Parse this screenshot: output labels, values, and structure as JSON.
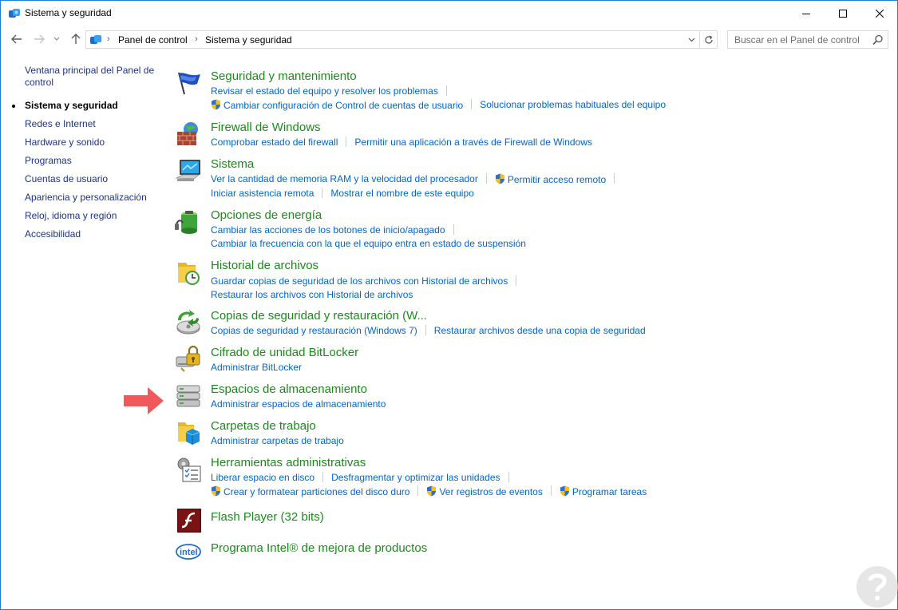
{
  "window": {
    "title": "Sistema y seguridad"
  },
  "address": {
    "breadcrumb": [
      "Panel de control",
      "Sistema y seguridad"
    ]
  },
  "search": {
    "placeholder": "Buscar en el Panel de control"
  },
  "sidebar": {
    "items": [
      {
        "label": "Ventana principal del Panel de control"
      },
      {
        "label": "Sistema y seguridad"
      },
      {
        "label": "Redes e Internet"
      },
      {
        "label": "Hardware y sonido"
      },
      {
        "label": "Programas"
      },
      {
        "label": "Cuentas de usuario"
      },
      {
        "label": "Apariencia y personalización"
      },
      {
        "label": "Reloj, idioma y región"
      },
      {
        "label": "Accesibilidad"
      }
    ]
  },
  "categories": [
    {
      "title": "Seguridad y mantenimiento",
      "icon": "flag-icon",
      "links": [
        "Revisar el estado del equipo y resolver los problemas",
        "Cambiar configuración de Control de cuentas de usuario",
        "Solucionar problemas habituales del equipo"
      ]
    },
    {
      "title": "Firewall de Windows",
      "icon": "firewall-icon",
      "links": [
        "Comprobar estado del firewall",
        "Permitir una aplicación a través de Firewall de Windows"
      ]
    },
    {
      "title": "Sistema",
      "icon": "computer-icon",
      "links": [
        "Ver la cantidad de memoria RAM y la velocidad del procesador",
        "Permitir acceso remoto",
        "Iniciar asistencia remota",
        "Mostrar el nombre de este equipo"
      ]
    },
    {
      "title": "Opciones de energía",
      "icon": "battery-icon",
      "links": [
        "Cambiar las acciones de los botones de inicio/apagado",
        "Cambiar la frecuencia con la que el equipo entra en estado de suspensión"
      ]
    },
    {
      "title": "Historial de archivos",
      "icon": "file-history-icon",
      "links": [
        "Guardar copias de seguridad de los archivos con Historial de archivos",
        "Restaurar los archivos con Historial de archivos"
      ]
    },
    {
      "title": "Copias de seguridad y restauración (W...",
      "icon": "backup-icon",
      "links": [
        "Copias de seguridad y restauración (Windows 7)",
        "Restaurar archivos desde una copia de seguridad"
      ]
    },
    {
      "title": "Cifrado de unidad BitLocker",
      "icon": "bitlocker-icon",
      "links": [
        "Administrar BitLocker"
      ]
    },
    {
      "title": "Espacios de almacenamiento",
      "icon": "storage-spaces-icon",
      "links": [
        "Administrar espacios de almacenamiento"
      ]
    },
    {
      "title": "Carpetas de trabajo",
      "icon": "work-folders-icon",
      "links": [
        "Administrar carpetas de trabajo"
      ]
    },
    {
      "title": "Herramientas administrativas",
      "icon": "admin-tools-icon",
      "links": [
        "Liberar espacio en disco",
        "Desfragmentar y optimizar las unidades",
        "Crear y formatear particiones del disco duro",
        "Ver registros de eventos",
        "Programar tareas"
      ]
    },
    {
      "title": "Flash Player (32 bits)",
      "icon": "flash-player-icon",
      "links": []
    },
    {
      "title": "Programa Intel® de mejora de productos",
      "icon": "intel-icon",
      "links": []
    }
  ],
  "colors": {
    "category_title": "#1d8a1d",
    "link": "#0066cc",
    "sidebar_link": "#1e3287",
    "highlight_arrow": "#f0585c"
  }
}
